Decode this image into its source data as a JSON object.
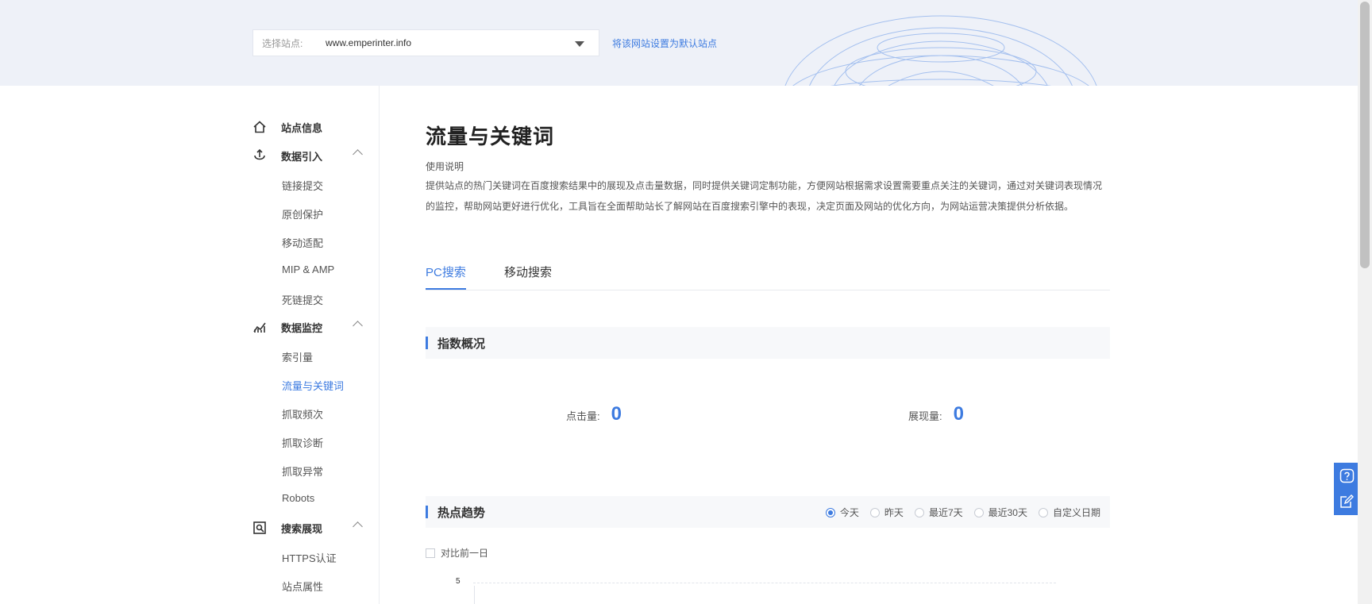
{
  "header": {
    "site_label": "选择站点:",
    "site_value": "www.emperinter.info",
    "set_default_link": "将该网站设置为默认站点"
  },
  "sidebar": {
    "groups": [
      {
        "label": "站点信息",
        "icon": "home-icon"
      },
      {
        "label": "数据引入",
        "icon": "data-import-icon"
      },
      {
        "label": "数据监控",
        "icon": "monitor-chart-icon"
      },
      {
        "label": "搜索展现",
        "icon": "search-display-icon"
      }
    ],
    "items": {
      "link_submit": "链接提交",
      "original_protect": "原创保护",
      "mobile_adapt": "移动适配",
      "mip_amp": "MIP & AMP",
      "dead_link": "死链提交",
      "index_volume": "索引量",
      "traffic_keywords": "流量与关键词",
      "crawl_frequency": "抓取频次",
      "crawl_diagnosis": "抓取诊断",
      "crawl_errors": "抓取异常",
      "robots": "Robots",
      "https_cert": "HTTPS认证",
      "site_properties": "站点属性"
    }
  },
  "main": {
    "title": "流量与关键词",
    "usage_title": "使用说明",
    "usage_text": "提供站点的热门关键词在百度搜索结果中的展现及点击量数据，同时提供关键词定制功能，方便网站根据需求设置需要重点关注的关键词，通过对关键词表现情况的监控，帮助网站更好进行优化，工具旨在全面帮助站长了解网站在百度搜索引擎中的表现，决定页面及网站的优化方向，为网站运营决策提供分析依据。",
    "tabs": [
      "PC搜索",
      "移动搜索"
    ],
    "overview_title": "指数概况",
    "clicks_label": "点击量:",
    "clicks_value": "0",
    "impressions_label": "展现量:",
    "impressions_value": "0",
    "trend_title": "热点趋势",
    "ranges": [
      "今天",
      "昨天",
      "最近7天",
      "最近30天",
      "自定义日期"
    ],
    "selected_range": "今天",
    "compare_label": "对比前一日",
    "chart_y_tick": "5"
  },
  "colors": {
    "accent": "#3d7be0",
    "banner_bg": "#eef1f8"
  }
}
